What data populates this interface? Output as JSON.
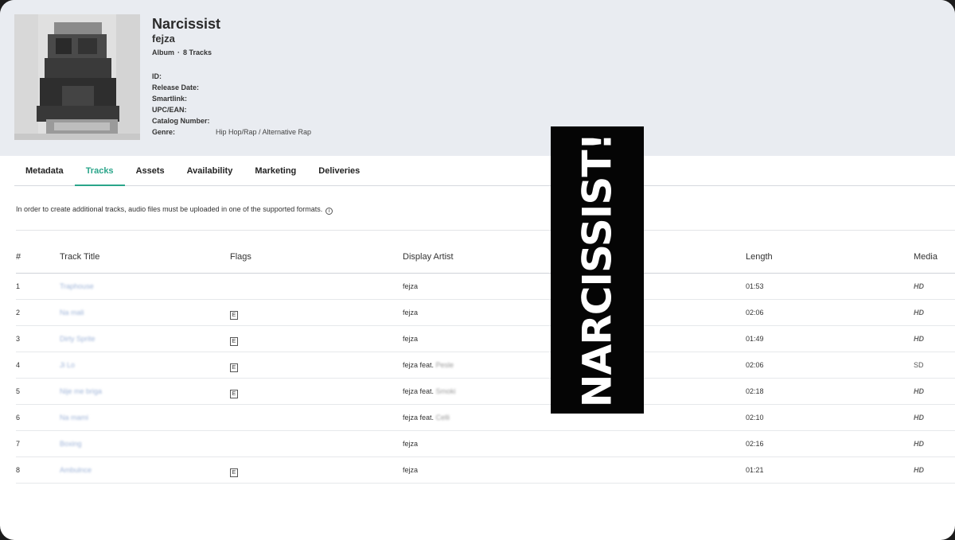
{
  "album": {
    "title": "Narcissist",
    "artist": "fejza",
    "type": "Album",
    "track_count": "8 Tracks",
    "fields": [
      {
        "label": "ID:",
        "value": ""
      },
      {
        "label": "Release Date:",
        "value": ""
      },
      {
        "label": "Smartlink:",
        "value": ""
      },
      {
        "label": "UPC/EAN:",
        "value": ""
      },
      {
        "label": "Catalog Number:",
        "value": ""
      },
      {
        "label": "Genre:",
        "value": "Hip Hop/Rap / Alternative Rap"
      }
    ]
  },
  "tabs": [
    "Metadata",
    "Tracks",
    "Assets",
    "Availability",
    "Marketing",
    "Deliveries"
  ],
  "active_tab": "Tracks",
  "notice": "In order to create additional tracks, audio files must be uploaded in one of the supported formats.",
  "table": {
    "columns": [
      "#",
      "Track Title",
      "Flags",
      "Display Artist",
      "Length",
      "Media"
    ],
    "rows": [
      {
        "num": "1",
        "title": "Traphouse",
        "flag": "",
        "artist": "fejza",
        "feat": "",
        "length": "01:53",
        "media": "HD"
      },
      {
        "num": "2",
        "title": "Na mali",
        "flag": "E",
        "artist": "fejza",
        "feat": "",
        "length": "02:06",
        "media": "HD"
      },
      {
        "num": "3",
        "title": "Dirty Sprite",
        "flag": "E",
        "artist": "fejza",
        "feat": "",
        "length": "01:49",
        "media": "HD"
      },
      {
        "num": "4",
        "title": "Ji Lo",
        "flag": "E",
        "artist": "fejza feat.",
        "feat": "Pesle",
        "length": "02:06",
        "media": "SD"
      },
      {
        "num": "5",
        "title": "Nije me briga",
        "flag": "E",
        "artist": "fejza feat.",
        "feat": "Smoki",
        "length": "02:18",
        "media": "HD"
      },
      {
        "num": "6",
        "title": "Na mami",
        "flag": "",
        "artist": "fejza feat.",
        "feat": "Celli",
        "length": "02:10",
        "media": "HD"
      },
      {
        "num": "7",
        "title": "Boxing",
        "flag": "",
        "artist": "fejza",
        "feat": "",
        "length": "02:16",
        "media": "HD"
      },
      {
        "num": "8",
        "title": "Ambulnce",
        "flag": "E",
        "artist": "fejza",
        "feat": "",
        "length": "01:21",
        "media": "HD"
      }
    ]
  },
  "banner": {
    "text": "NARCISSIST!"
  },
  "colors": {
    "accent": "#2aa58a",
    "header_bg": "#e9ecf1",
    "banner_bg": "#050505"
  }
}
